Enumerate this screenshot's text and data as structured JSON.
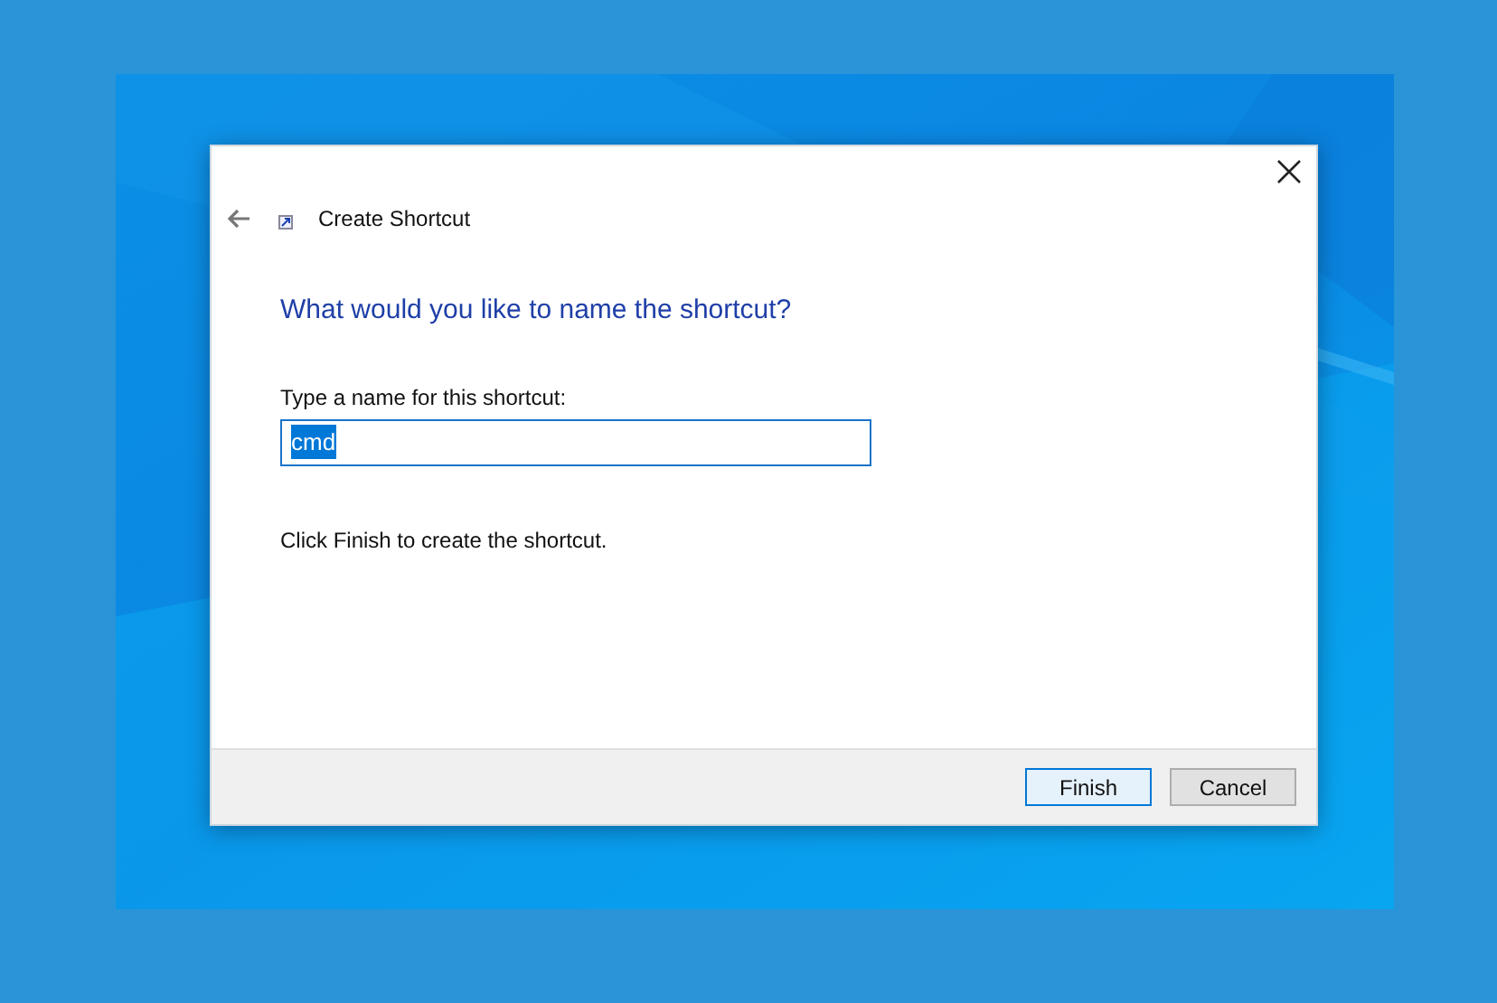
{
  "dialog": {
    "title": "Create Shortcut",
    "heading": "What would you like to name the shortcut?",
    "field": {
      "label": "Type a name for this shortcut:",
      "value": "cmd",
      "text_selected": true
    },
    "instruction": "Click Finish to create the shortcut.",
    "buttons": [
      {
        "label": "Finish",
        "default": true
      },
      {
        "label": "Cancel",
        "default": false
      }
    ]
  }
}
